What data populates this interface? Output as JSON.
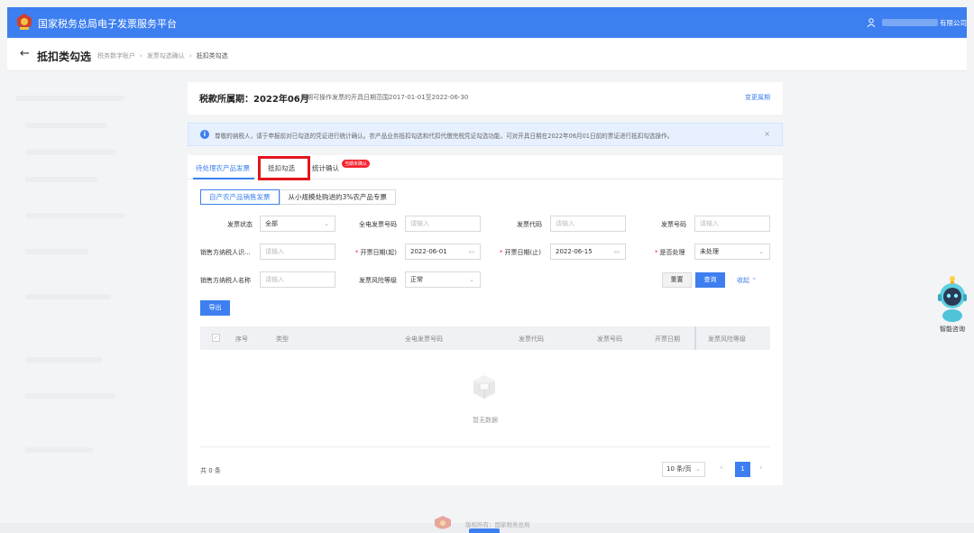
{
  "header": {
    "app_title": "国家税务总局电子发票服务平台",
    "company_suffix": "有限公司"
  },
  "breadcrumb": {
    "page_title": "抵扣类勾选",
    "items": [
      "税务数字账户",
      "发票勾选确认",
      "抵扣类勾选"
    ]
  },
  "period": {
    "label": "税款所属期：2022年06月",
    "hint": "当期可操作发票的开具日期范围2017-01-01至2022-06-30",
    "change_link": "变更属期"
  },
  "notice": {
    "text": "尊敬的纳税人，请于申报前对已勾选的凭证进行统计确认。农产品业务抵扣勾选和代扣代缴完税凭证勾选功能，可对开具日期在2022年06月01日前的票证进行抵扣勾选操作。"
  },
  "tabs": [
    {
      "label": "待处理农产品发票"
    },
    {
      "label": "抵扣勾选"
    },
    {
      "label": "统计确认"
    }
  ],
  "tab_badge": "当期未确认",
  "subtabs": [
    {
      "label": "自产农产品销售发票"
    },
    {
      "label": "从小规模处购进的3%农产品专票"
    }
  ],
  "filters": {
    "invoice_status": {
      "label": "发票状态",
      "value": "全部"
    },
    "full_invoice_no": {
      "label": "全电发票号码",
      "placeholder": "请输入"
    },
    "invoice_code": {
      "label": "发票代码",
      "placeholder": "请输入"
    },
    "invoice_no": {
      "label": "发票号码",
      "placeholder": "请输入"
    },
    "seller_taxid": {
      "label": "销售方纳税人识...",
      "placeholder": "请输入"
    },
    "date_start": {
      "label": "开票日期(起)",
      "value": "2022-06-01"
    },
    "date_end": {
      "label": "开票日期(止)",
      "value": "2022-06-15"
    },
    "processed": {
      "label": "是否处理",
      "value": "未处理"
    },
    "seller_name": {
      "label": "销售方纳税人名称",
      "placeholder": "请输入"
    },
    "risk_level": {
      "label": "发票风险等级",
      "value": "正常"
    }
  },
  "buttons": {
    "reset": "重置",
    "query": "查询",
    "collapse": "收起",
    "export": "导出"
  },
  "table": {
    "columns": [
      "序号",
      "类型",
      "全电发票号码",
      "发票代码",
      "发票号码",
      "开票日期",
      "发票风险等级"
    ],
    "empty_text": "暂无数据"
  },
  "pagination": {
    "total": "共 0 条",
    "page_size": "10 条/页",
    "current_page": "1"
  },
  "assistant": {
    "label": "智能咨询"
  },
  "footer": {
    "text": "版权所有：国家税务总局"
  },
  "colors": {
    "brand": "#3d7ff0",
    "highlight_box": "#e2141c",
    "badge": "#f5222d"
  }
}
